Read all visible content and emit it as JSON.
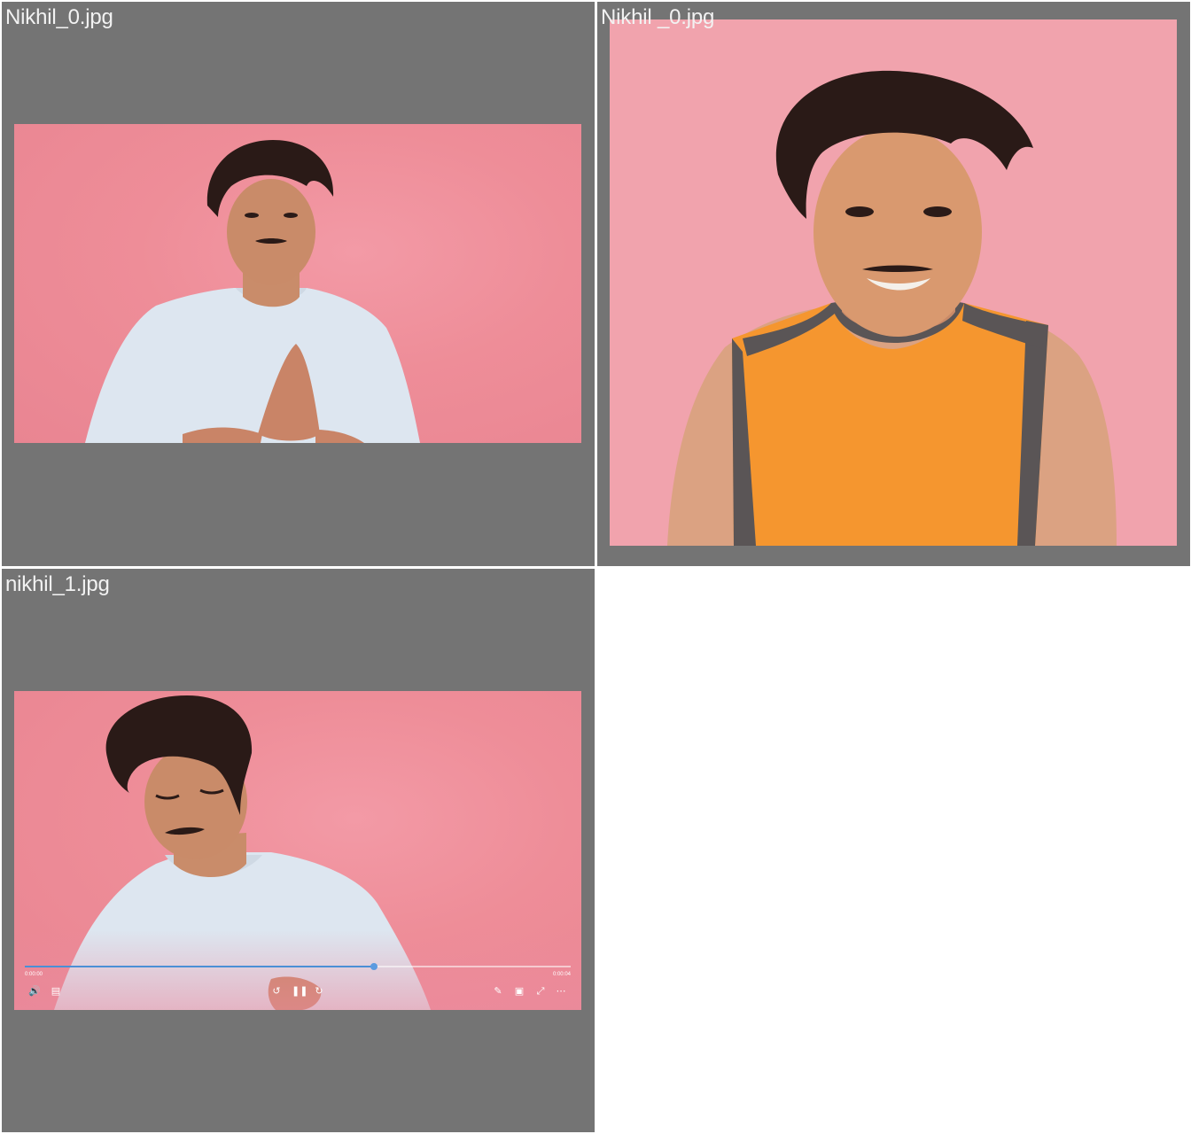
{
  "tiles": [
    {
      "caption": "Nikhil_0.jpg"
    },
    {
      "caption": "Nikhil _0.jpg"
    },
    {
      "caption": "nikhil_1.jpg"
    }
  ],
  "player": {
    "current_time": "0:00:00",
    "total_time": "0:00:04",
    "progress": 0.64,
    "controls": [
      "volume-icon",
      "captions-icon",
      "rewind-icon",
      "pause-icon",
      "forward-icon",
      "edit-icon",
      "miniplayer-icon",
      "fullscreen-icon",
      "more-icon"
    ]
  },
  "colors": {
    "tile_background": "#747474",
    "wall_pink": "#ee8d98",
    "shirt_light_blue": "#dde6f0",
    "tank_orange": "#f5962f",
    "tank_gray": "#5a5556",
    "progress_blue": "#4a8fd6"
  }
}
